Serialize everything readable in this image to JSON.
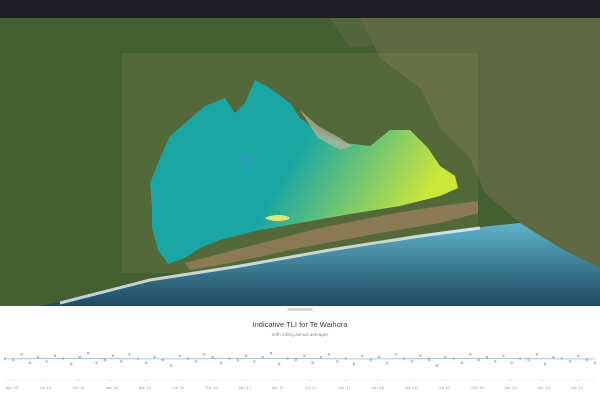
{
  "map": {
    "feature_name": "Te Waihora",
    "colors": {
      "farmland": "#445f32",
      "hills": "#5f6a45",
      "lake_low": "#1aa6a3",
      "lake_high": "#cde63a",
      "spit": "#8c7a55",
      "ocean_shallow": "#5fb3c8",
      "ocean_deep": "#1d4a63",
      "marker": "#3a8fd9"
    }
  },
  "panel": {
    "title": "Indicative TLI for Te Waihora",
    "subtitle": "With rolling annual averages"
  },
  "chart_data": {
    "type": "scatter",
    "title": "Indicative TLI for Te Waihora",
    "subtitle": "With rolling annual averages",
    "categories": [
      "Apr '15",
      "Jul '15",
      "Oct '15",
      "Jan '16",
      "Apr '16",
      "Jul '16",
      "Oct '16",
      "Jan '17",
      "Apr '17",
      "Jul '17",
      "Oct '17",
      "Jan '18",
      "Apr '18",
      "Jul '18",
      "Oct '18",
      "Jan '19",
      "Apr '19",
      "Jul '19"
    ],
    "series": [
      {
        "values": [
          6.1,
          6.0,
          6.4,
          5.8,
          6.2,
          5.9,
          6.3,
          6.1,
          5.7,
          6.2,
          6.5,
          5.8,
          6.0,
          6.3,
          5.9,
          6.4,
          6.1,
          5.8,
          6.2,
          6.0,
          5.6,
          6.3,
          6.1,
          5.9,
          6.4,
          6.2,
          5.8,
          6.1,
          6.0,
          6.3,
          5.9,
          6.2,
          6.5,
          5.7,
          6.1,
          6.0,
          6.3,
          5.8,
          6.2,
          6.4,
          5.9,
          6.1,
          5.7,
          6.3,
          6.0,
          6.2,
          5.8,
          6.4,
          6.1,
          5.9,
          6.3,
          6.0,
          5.6,
          6.2,
          6.1,
          5.8,
          6.4,
          6.0,
          6.2,
          5.9,
          6.3,
          5.8,
          6.1,
          6.0,
          6.4,
          5.7,
          6.2,
          6.1,
          5.9,
          6.3,
          6.0,
          5.8
        ]
      },
      {
        "values": [
          6.08,
          6.09,
          6.1,
          6.09,
          6.08,
          6.08,
          6.09,
          6.1,
          6.1,
          6.09,
          6.08,
          6.08,
          6.09,
          6.1,
          6.1,
          6.09,
          6.08,
          6.08
        ]
      }
    ],
    "ylim": [
      5.0,
      7.0
    ]
  }
}
